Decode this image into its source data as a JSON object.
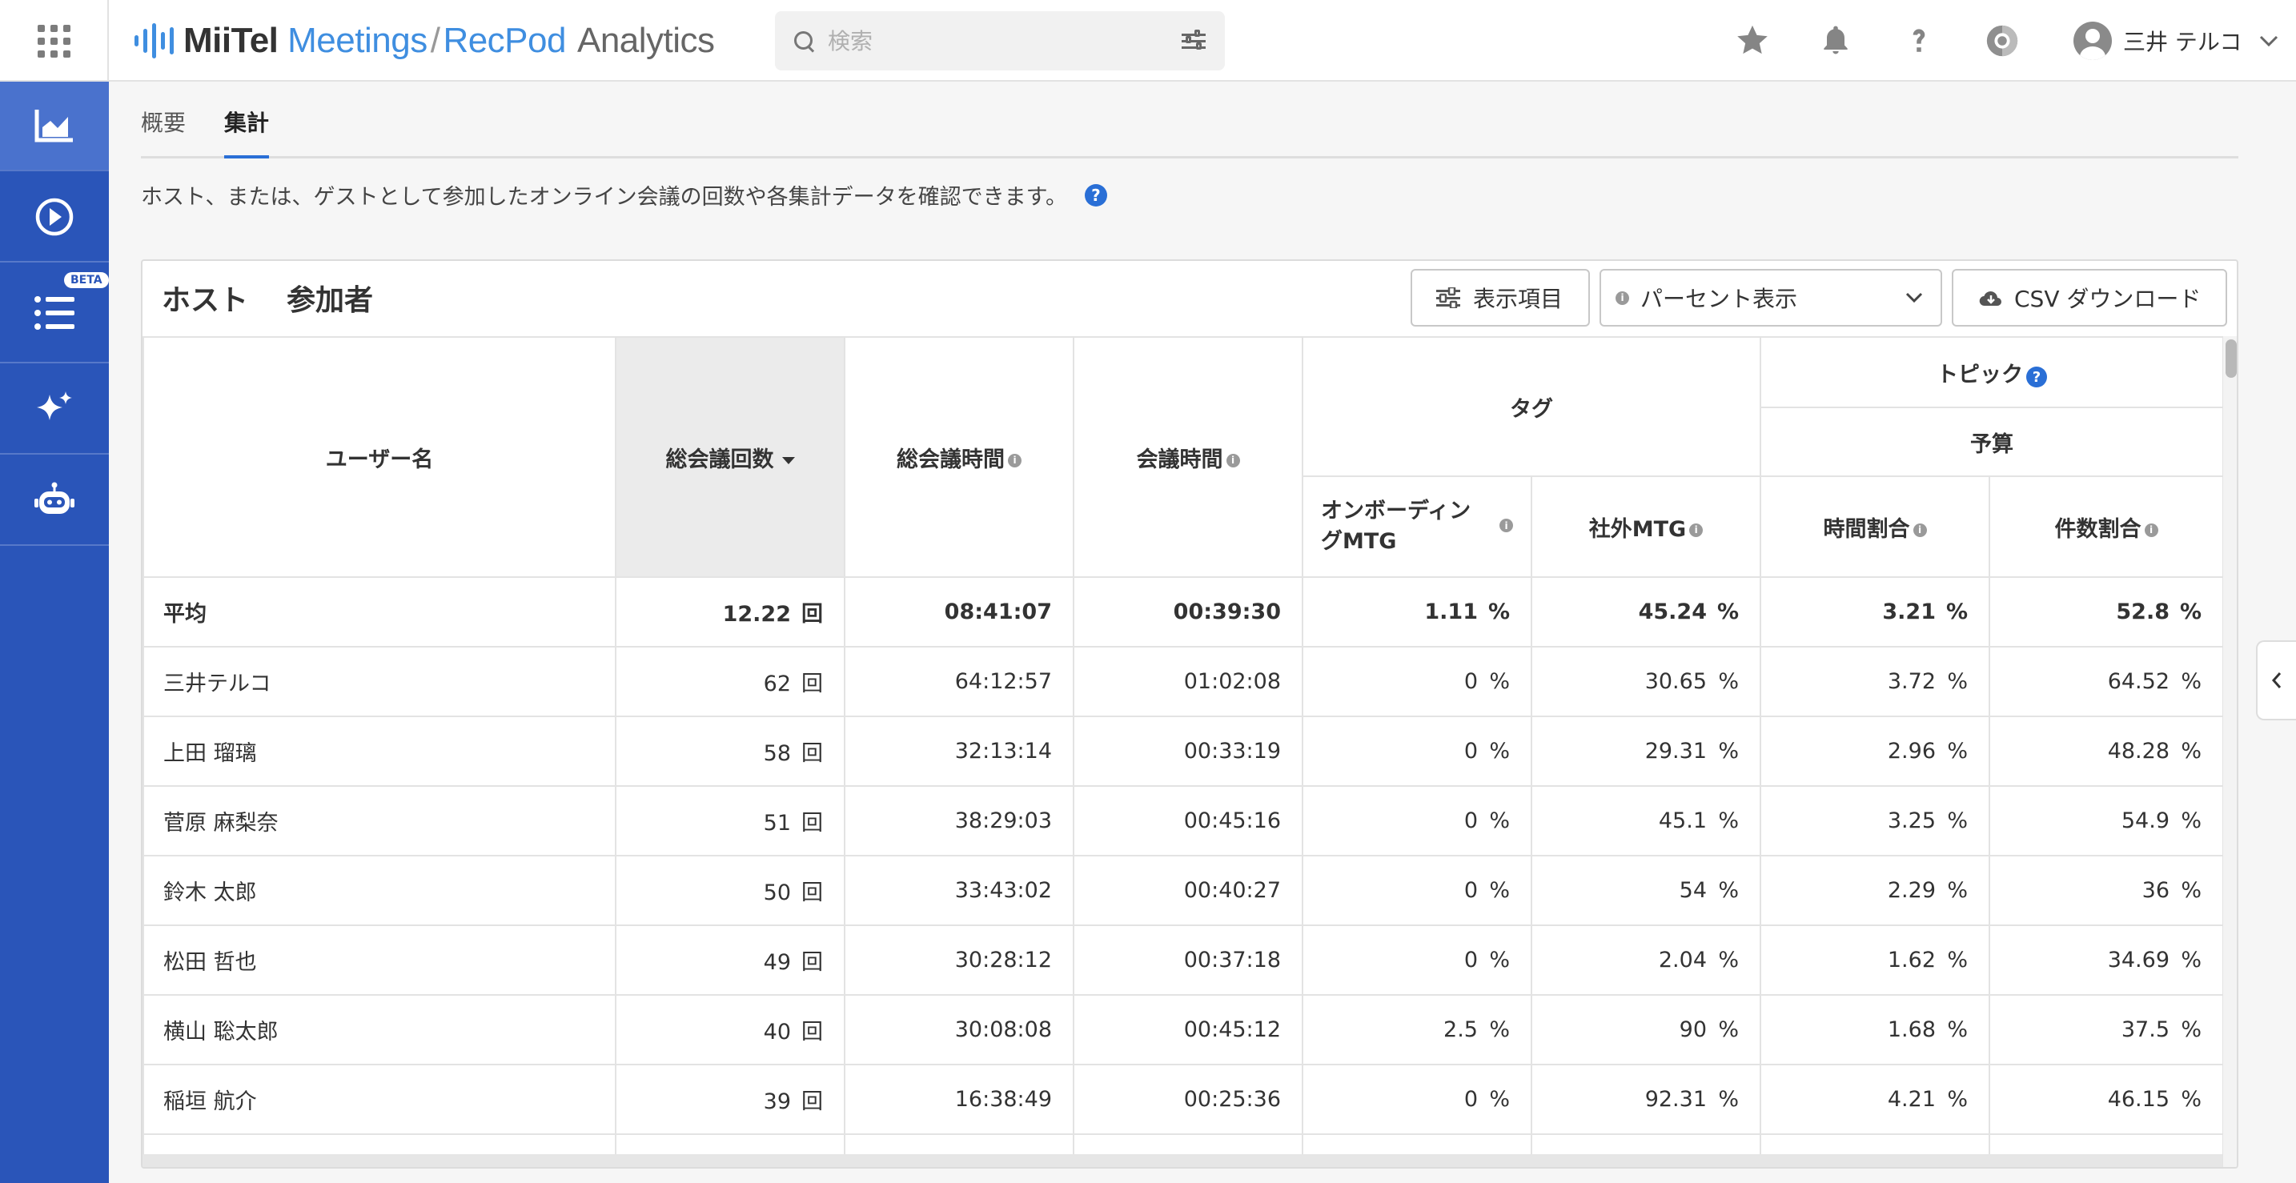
{
  "header": {
    "logo_miitel": "MiiTel",
    "logo_meetings": "Meetings",
    "logo_slash": "/",
    "logo_recpod": "RecPod",
    "logo_analytics": "Analytics",
    "search_placeholder": "検索",
    "user_name": "三井 テルコ"
  },
  "sidebar": {
    "beta_label": "BETA",
    "items": [
      {
        "icon": "chart-area-icon",
        "active": true
      },
      {
        "icon": "play-circle-icon",
        "active": false
      },
      {
        "icon": "list-icon",
        "active": false,
        "badge": "BETA"
      },
      {
        "icon": "sparkle-icon",
        "active": false
      },
      {
        "icon": "robot-icon",
        "active": false
      }
    ]
  },
  "tabs": {
    "overview": "概要",
    "aggregate": "集計"
  },
  "description": "ホスト、または、ゲストとして参加したオンライン会議の回数や各集計データを確認できます。",
  "help_symbol": "?",
  "card": {
    "tab_host": "ホスト",
    "tab_participants": "参加者",
    "display_items_label": "表示項目",
    "percent_select_value": "パーセント表示",
    "csv_label": "CSV ダウンロード"
  },
  "table": {
    "headers": {
      "user_name": "ユーザー名",
      "total_meetings": "総会議回数",
      "total_time": "総会議時間",
      "meeting_time": "会議時間",
      "tag_group": "タグ",
      "topic_group": "トピック",
      "budget_group": "予算",
      "onboarding_mtg": "オンボーディングMTG",
      "external_mtg": "社外MTG",
      "time_ratio": "時間割合",
      "count_ratio": "件数割合"
    },
    "info_symbol": "i",
    "count_unit": "回",
    "percent_unit": "%",
    "rows": [
      {
        "name": "平均",
        "count": "12.22",
        "total_time": "08:41:07",
        "meeting_time": "00:39:30",
        "onboarding": "1.11",
        "external": "45.24",
        "time_ratio": "3.21",
        "count_ratio": "52.8"
      },
      {
        "name": "三井テルコ",
        "count": "62",
        "total_time": "64:12:57",
        "meeting_time": "01:02:08",
        "onboarding": "0",
        "external": "30.65",
        "time_ratio": "3.72",
        "count_ratio": "64.52"
      },
      {
        "name": "上田 瑠璃",
        "count": "58",
        "total_time": "32:13:14",
        "meeting_time": "00:33:19",
        "onboarding": "0",
        "external": "29.31",
        "time_ratio": "2.96",
        "count_ratio": "48.28"
      },
      {
        "name": "菅原 麻梨奈",
        "count": "51",
        "total_time": "38:29:03",
        "meeting_time": "00:45:16",
        "onboarding": "0",
        "external": "45.1",
        "time_ratio": "3.25",
        "count_ratio": "54.9"
      },
      {
        "name": "鈴木 太郎",
        "count": "50",
        "total_time": "33:43:02",
        "meeting_time": "00:40:27",
        "onboarding": "0",
        "external": "54",
        "time_ratio": "2.29",
        "count_ratio": "36"
      },
      {
        "name": "松田 哲也",
        "count": "49",
        "total_time": "30:28:12",
        "meeting_time": "00:37:18",
        "onboarding": "0",
        "external": "2.04",
        "time_ratio": "1.62",
        "count_ratio": "34.69"
      },
      {
        "name": "横山 聡太郎",
        "count": "40",
        "total_time": "30:08:08",
        "meeting_time": "00:45:12",
        "onboarding": "2.5",
        "external": "90",
        "time_ratio": "1.68",
        "count_ratio": "37.5"
      },
      {
        "name": "稲垣 航介",
        "count": "39",
        "total_time": "16:38:49",
        "meeting_time": "00:25:36",
        "onboarding": "0",
        "external": "92.31",
        "time_ratio": "4.21",
        "count_ratio": "46.15"
      }
    ]
  },
  "colors": {
    "sidebar": "#2a55b9",
    "sidebar_active": "#4a72cd",
    "accent": "#2a6fd6",
    "logo_blue": "#3f8ee0"
  }
}
